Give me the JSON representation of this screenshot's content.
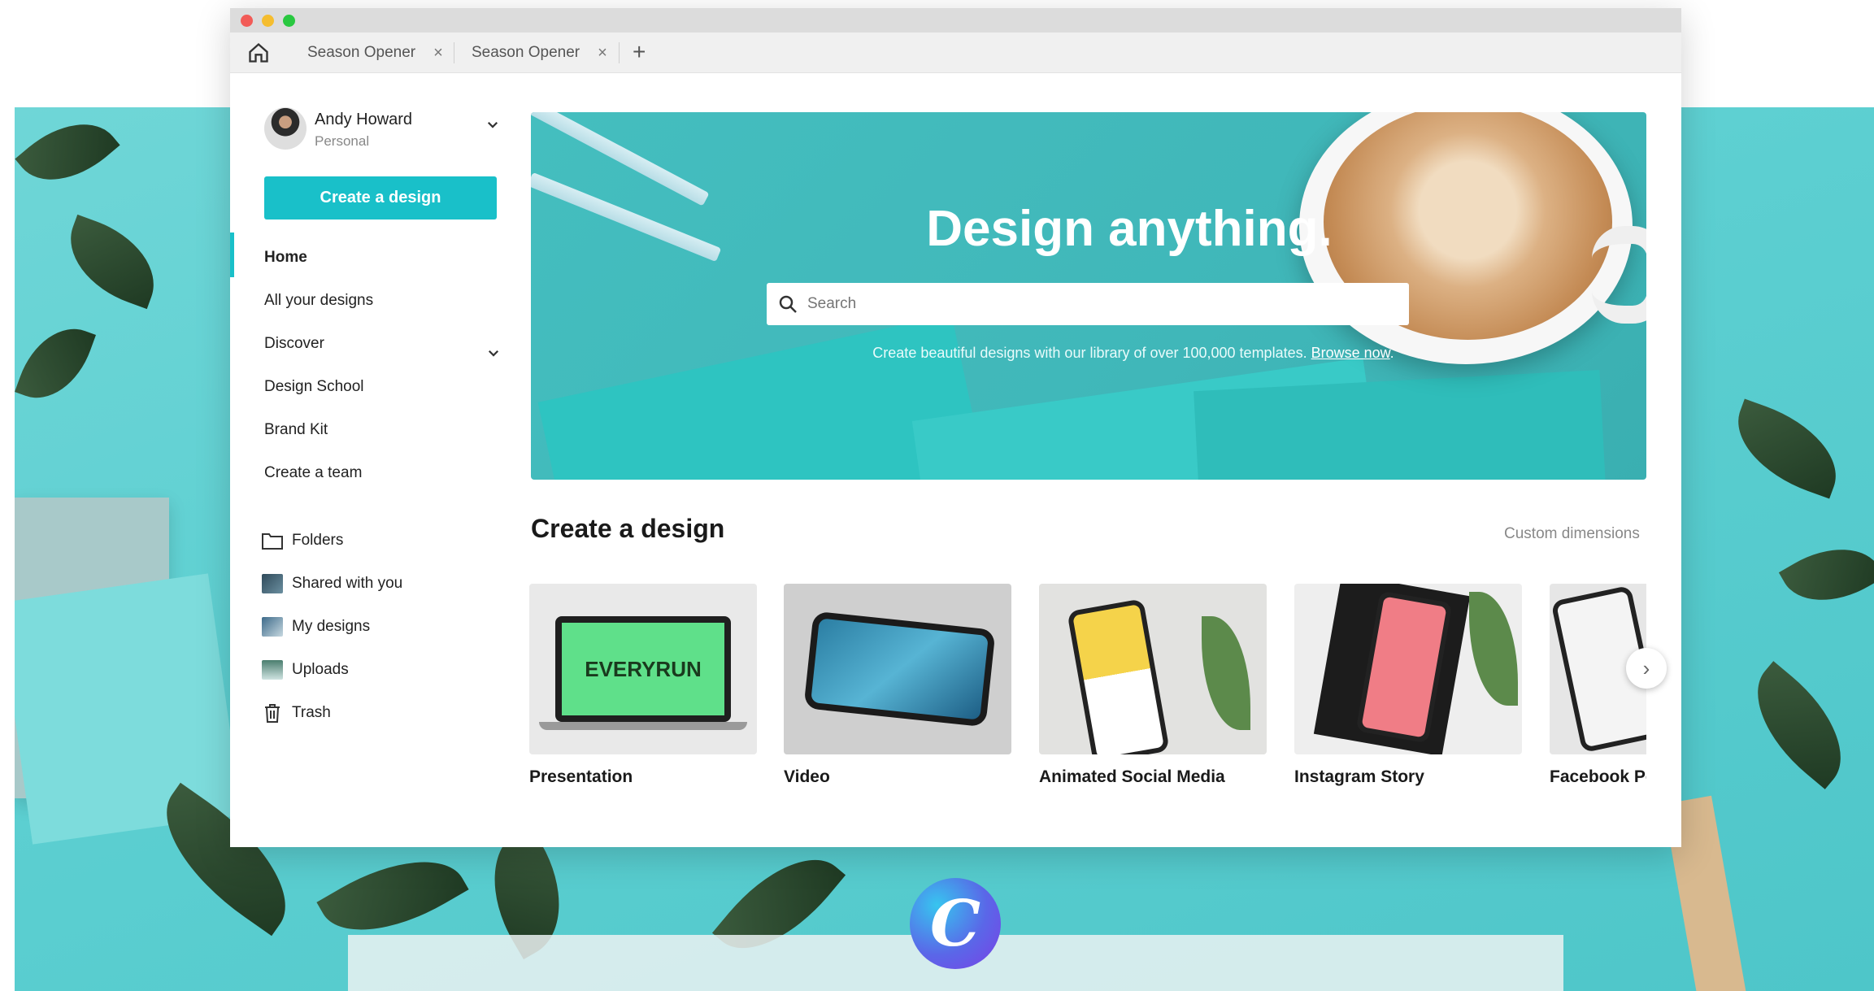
{
  "browser": {
    "tabs": [
      {
        "label": "Season Opener",
        "close": "×"
      },
      {
        "label": "Season Opener",
        "close": "×"
      }
    ],
    "new_tab": "+"
  },
  "account": {
    "name": "Andy Howard",
    "plan": "Personal"
  },
  "sidebar": {
    "create_button": "Create a design",
    "nav": [
      "Home",
      "All your designs",
      "Discover",
      "Design School",
      "Brand Kit",
      "Create a team"
    ],
    "library": [
      "Folders",
      "Shared with you",
      "My designs",
      "Uploads",
      "Trash"
    ]
  },
  "hero": {
    "title": "Design anything.",
    "search_placeholder": "Search",
    "subtitle": "Create beautiful designs with our library of over 100,000 templates.",
    "browse_link": "Browse now"
  },
  "create_section": {
    "title": "Create a design",
    "custom_dimensions": "Custom dimensions",
    "cards": [
      {
        "label": "Presentation",
        "preview_text": "EVERYRUN"
      },
      {
        "label": "Video"
      },
      {
        "label": "Animated Social Media"
      },
      {
        "label": "Instagram Story"
      },
      {
        "label": "Facebook Po"
      }
    ],
    "next": "›"
  },
  "brand": {
    "logo_letter": "C"
  },
  "colors": {
    "accent": "#19c0c9",
    "hero_bg": "#42bbbd",
    "page_bg": "#5fd1d3"
  }
}
